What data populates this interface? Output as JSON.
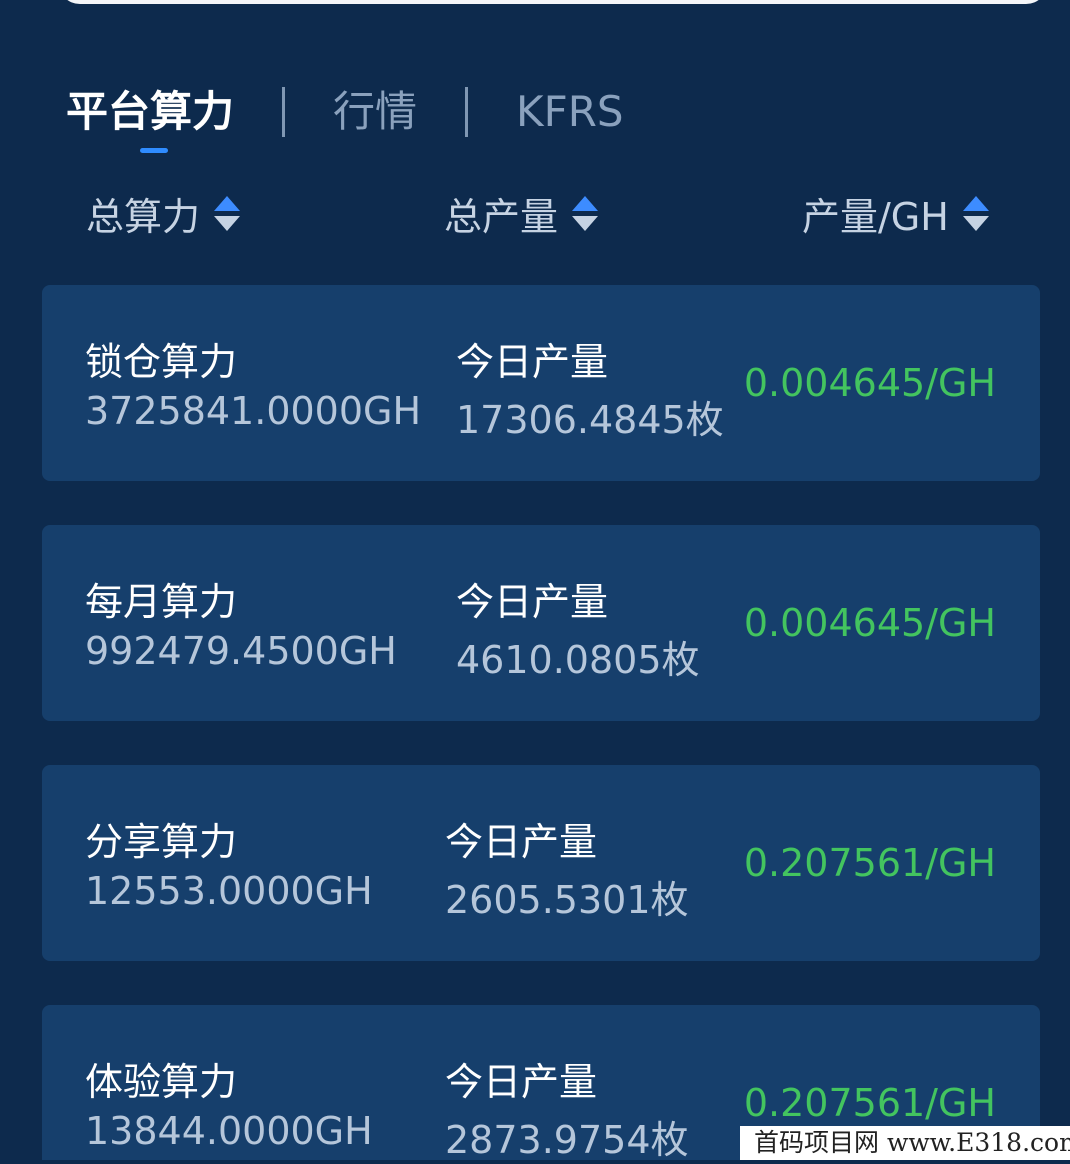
{
  "tabs": [
    {
      "label": "平台算力",
      "active": true
    },
    {
      "label": "行情",
      "active": false
    },
    {
      "label": "KFRS",
      "active": false
    }
  ],
  "column_headers": [
    {
      "label": "总算力",
      "icon": "sort-icon"
    },
    {
      "label": "总产量",
      "icon": "sort-icon"
    },
    {
      "label": "产量/GH",
      "icon": "sort-icon"
    }
  ],
  "cards": [
    {
      "name": "锁仓算力",
      "hashrate": "3725841.0000GH",
      "output_label": "今日产量",
      "output": "17306.4845枚",
      "rate": "0.004645/GH"
    },
    {
      "name": "每月算力",
      "hashrate": "992479.4500GH",
      "output_label": "今日产量",
      "output": "4610.0805枚",
      "rate": "0.004645/GH"
    },
    {
      "name": "分享算力",
      "hashrate": "12553.0000GH",
      "output_label": "今日产量",
      "output": "2605.5301枚",
      "rate": "0.207561/GH"
    },
    {
      "name": "体验算力",
      "hashrate": "13844.0000GH",
      "output_label": "今日产量",
      "output": "2873.9754枚",
      "rate": "0.207561/GH"
    }
  ],
  "watermark": "首码项目网 www.E318.com",
  "colors": {
    "background": "#0d2a4d",
    "card": "#163f6c",
    "rate_green": "#43c45f",
    "accent_blue": "#2f8cff"
  }
}
